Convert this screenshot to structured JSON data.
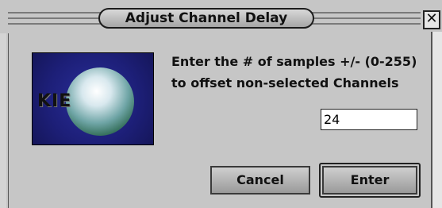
{
  "window": {
    "title": "Adjust Channel Delay",
    "close_icon": "✕"
  },
  "logo": {
    "icon": "kie-logo",
    "text": "KIE"
  },
  "prompt": {
    "line1": "Enter the # of samples +/- (0-255)",
    "line2": "to offset non-selected Channels"
  },
  "delay_input": {
    "value": "24"
  },
  "buttons": {
    "cancel_label": "Cancel",
    "enter_label": "Enter"
  }
}
